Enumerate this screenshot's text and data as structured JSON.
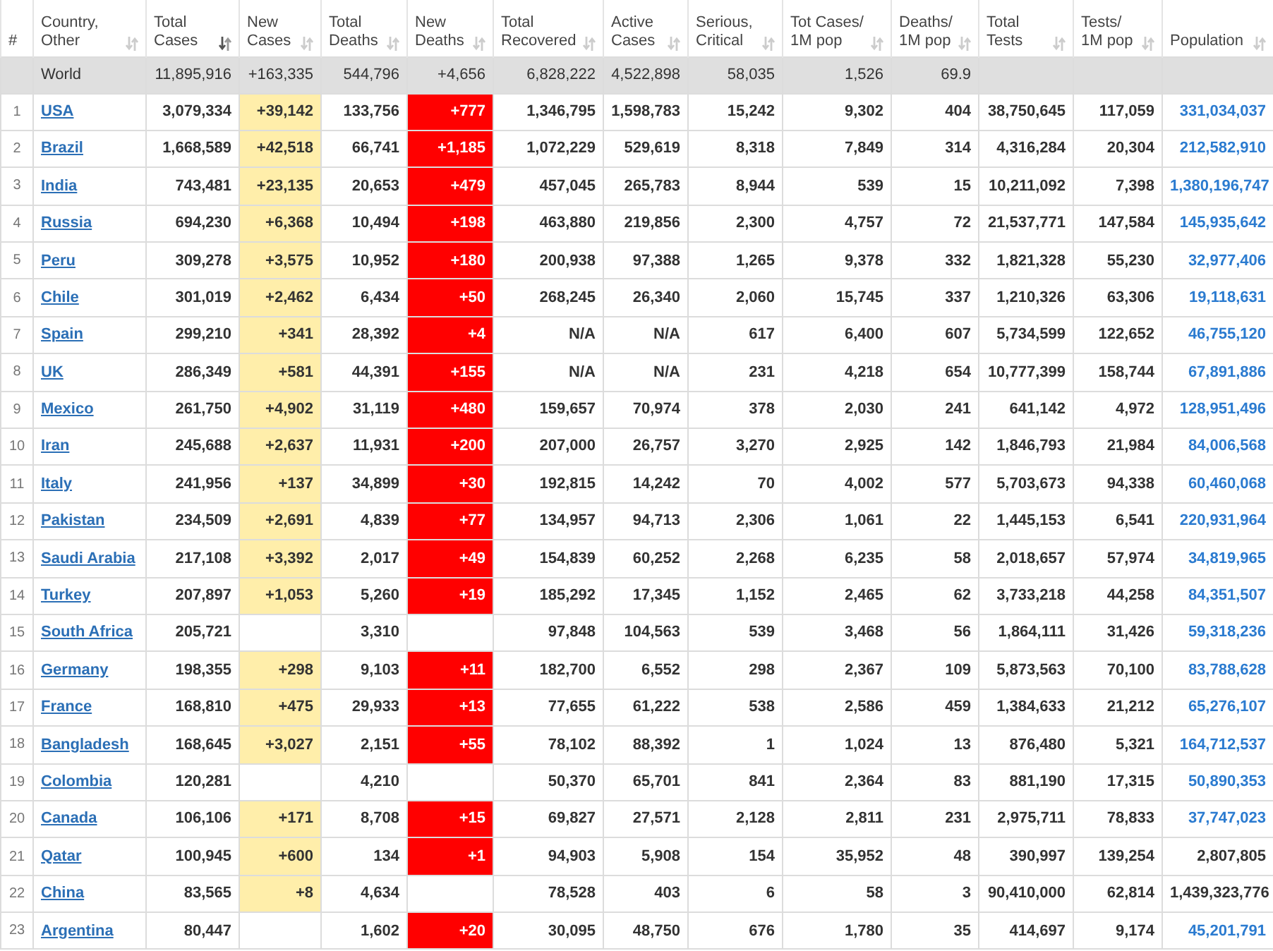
{
  "columns": [
    {
      "label_lines": [
        "#"
      ],
      "sortable": false
    },
    {
      "label_lines": [
        "Country,",
        "Other"
      ],
      "sortable": true,
      "sorted": false
    },
    {
      "label_lines": [
        "Total",
        "Cases"
      ],
      "sortable": true,
      "sorted": true
    },
    {
      "label_lines": [
        "New",
        "Cases"
      ],
      "sortable": true,
      "sorted": false
    },
    {
      "label_lines": [
        "Total",
        "Deaths"
      ],
      "sortable": true,
      "sorted": false
    },
    {
      "label_lines": [
        "New",
        "Deaths"
      ],
      "sortable": true,
      "sorted": false
    },
    {
      "label_lines": [
        "Total",
        "Recovered"
      ],
      "sortable": true,
      "sorted": false
    },
    {
      "label_lines": [
        "Active",
        "Cases"
      ],
      "sortable": true,
      "sorted": false
    },
    {
      "label_lines": [
        "Serious,",
        "Critical"
      ],
      "sortable": true,
      "sorted": false
    },
    {
      "label_lines": [
        "Tot Cases/",
        "1M pop"
      ],
      "sortable": true,
      "sorted": false
    },
    {
      "label_lines": [
        "Deaths/",
        "1M pop"
      ],
      "sortable": true,
      "sorted": false
    },
    {
      "label_lines": [
        "Total",
        "Tests"
      ],
      "sortable": true,
      "sorted": false
    },
    {
      "label_lines": [
        "Tests/",
        "1M pop"
      ],
      "sortable": true,
      "sorted": false
    },
    {
      "label_lines": [
        "Population"
      ],
      "sortable": true,
      "sorted": false
    }
  ],
  "world": {
    "country": "World",
    "total_cases": "11,895,916",
    "new_cases": "+163,335",
    "total_deaths": "544,796",
    "new_deaths": "+4,656",
    "total_recovered": "6,828,222",
    "active_cases": "4,522,898",
    "serious_critical": "58,035",
    "tot_cases_per_1m": "1,526",
    "deaths_per_1m": "69.9"
  },
  "rows": [
    {
      "num": "1",
      "country": "USA",
      "total_cases": "3,079,334",
      "new_cases": "+39,142",
      "total_deaths": "133,756",
      "new_deaths": "+777",
      "total_recovered": "1,346,795",
      "active_cases": "1,598,783",
      "serious_critical": "15,242",
      "tot_cases_per_1m": "9,302",
      "deaths_per_1m": "404",
      "total_tests": "38,750,645",
      "tests_per_1m": "117,059",
      "population": "331,034,037",
      "population_link": true
    },
    {
      "num": "2",
      "country": "Brazil",
      "total_cases": "1,668,589",
      "new_cases": "+42,518",
      "total_deaths": "66,741",
      "new_deaths": "+1,185",
      "total_recovered": "1,072,229",
      "active_cases": "529,619",
      "serious_critical": "8,318",
      "tot_cases_per_1m": "7,849",
      "deaths_per_1m": "314",
      "total_tests": "4,316,284",
      "tests_per_1m": "20,304",
      "population": "212,582,910",
      "population_link": true
    },
    {
      "num": "3",
      "country": "India",
      "total_cases": "743,481",
      "new_cases": "+23,135",
      "total_deaths": "20,653",
      "new_deaths": "+479",
      "total_recovered": "457,045",
      "active_cases": "265,783",
      "serious_critical": "8,944",
      "tot_cases_per_1m": "539",
      "deaths_per_1m": "15",
      "total_tests": "10,211,092",
      "tests_per_1m": "7,398",
      "population": "1,380,196,747",
      "population_link": true
    },
    {
      "num": "4",
      "country": "Russia",
      "total_cases": "694,230",
      "new_cases": "+6,368",
      "total_deaths": "10,494",
      "new_deaths": "+198",
      "total_recovered": "463,880",
      "active_cases": "219,856",
      "serious_critical": "2,300",
      "tot_cases_per_1m": "4,757",
      "deaths_per_1m": "72",
      "total_tests": "21,537,771",
      "tests_per_1m": "147,584",
      "population": "145,935,642",
      "population_link": true
    },
    {
      "num": "5",
      "country": "Peru",
      "total_cases": "309,278",
      "new_cases": "+3,575",
      "total_deaths": "10,952",
      "new_deaths": "+180",
      "total_recovered": "200,938",
      "active_cases": "97,388",
      "serious_critical": "1,265",
      "tot_cases_per_1m": "9,378",
      "deaths_per_1m": "332",
      "total_tests": "1,821,328",
      "tests_per_1m": "55,230",
      "population": "32,977,406",
      "population_link": true
    },
    {
      "num": "6",
      "country": "Chile",
      "total_cases": "301,019",
      "new_cases": "+2,462",
      "total_deaths": "6,434",
      "new_deaths": "+50",
      "total_recovered": "268,245",
      "active_cases": "26,340",
      "serious_critical": "2,060",
      "tot_cases_per_1m": "15,745",
      "deaths_per_1m": "337",
      "total_tests": "1,210,326",
      "tests_per_1m": "63,306",
      "population": "19,118,631",
      "population_link": true
    },
    {
      "num": "7",
      "country": "Spain",
      "total_cases": "299,210",
      "new_cases": "+341",
      "total_deaths": "28,392",
      "new_deaths": "+4",
      "total_recovered": "N/A",
      "active_cases": "N/A",
      "serious_critical": "617",
      "tot_cases_per_1m": "6,400",
      "deaths_per_1m": "607",
      "total_tests": "5,734,599",
      "tests_per_1m": "122,652",
      "population": "46,755,120",
      "population_link": true
    },
    {
      "num": "8",
      "country": "UK",
      "total_cases": "286,349",
      "new_cases": "+581",
      "total_deaths": "44,391",
      "new_deaths": "+155",
      "total_recovered": "N/A",
      "active_cases": "N/A",
      "serious_critical": "231",
      "tot_cases_per_1m": "4,218",
      "deaths_per_1m": "654",
      "total_tests": "10,777,399",
      "tests_per_1m": "158,744",
      "population": "67,891,886",
      "population_link": true
    },
    {
      "num": "9",
      "country": "Mexico",
      "total_cases": "261,750",
      "new_cases": "+4,902",
      "total_deaths": "31,119",
      "new_deaths": "+480",
      "total_recovered": "159,657",
      "active_cases": "70,974",
      "serious_critical": "378",
      "tot_cases_per_1m": "2,030",
      "deaths_per_1m": "241",
      "total_tests": "641,142",
      "tests_per_1m": "4,972",
      "population": "128,951,496",
      "population_link": true
    },
    {
      "num": "10",
      "country": "Iran",
      "total_cases": "245,688",
      "new_cases": "+2,637",
      "total_deaths": "11,931",
      "new_deaths": "+200",
      "total_recovered": "207,000",
      "active_cases": "26,757",
      "serious_critical": "3,270",
      "tot_cases_per_1m": "2,925",
      "deaths_per_1m": "142",
      "total_tests": "1,846,793",
      "tests_per_1m": "21,984",
      "population": "84,006,568",
      "population_link": true
    },
    {
      "num": "11",
      "country": "Italy",
      "total_cases": "241,956",
      "new_cases": "+137",
      "total_deaths": "34,899",
      "new_deaths": "+30",
      "total_recovered": "192,815",
      "active_cases": "14,242",
      "serious_critical": "70",
      "tot_cases_per_1m": "4,002",
      "deaths_per_1m": "577",
      "total_tests": "5,703,673",
      "tests_per_1m": "94,338",
      "population": "60,460,068",
      "population_link": true
    },
    {
      "num": "12",
      "country": "Pakistan",
      "total_cases": "234,509",
      "new_cases": "+2,691",
      "total_deaths": "4,839",
      "new_deaths": "+77",
      "total_recovered": "134,957",
      "active_cases": "94,713",
      "serious_critical": "2,306",
      "tot_cases_per_1m": "1,061",
      "deaths_per_1m": "22",
      "total_tests": "1,445,153",
      "tests_per_1m": "6,541",
      "population": "220,931,964",
      "population_link": true
    },
    {
      "num": "13",
      "country": "Saudi Arabia",
      "total_cases": "217,108",
      "new_cases": "+3,392",
      "total_deaths": "2,017",
      "new_deaths": "+49",
      "total_recovered": "154,839",
      "active_cases": "60,252",
      "serious_critical": "2,268",
      "tot_cases_per_1m": "6,235",
      "deaths_per_1m": "58",
      "total_tests": "2,018,657",
      "tests_per_1m": "57,974",
      "population": "34,819,965",
      "population_link": true
    },
    {
      "num": "14",
      "country": "Turkey",
      "total_cases": "207,897",
      "new_cases": "+1,053",
      "total_deaths": "5,260",
      "new_deaths": "+19",
      "total_recovered": "185,292",
      "active_cases": "17,345",
      "serious_critical": "1,152",
      "tot_cases_per_1m": "2,465",
      "deaths_per_1m": "62",
      "total_tests": "3,733,218",
      "tests_per_1m": "44,258",
      "population": "84,351,507",
      "population_link": true
    },
    {
      "num": "15",
      "country": "South Africa",
      "total_cases": "205,721",
      "total_deaths": "3,310",
      "total_recovered": "97,848",
      "active_cases": "104,563",
      "serious_critical": "539",
      "tot_cases_per_1m": "3,468",
      "deaths_per_1m": "56",
      "total_tests": "1,864,111",
      "tests_per_1m": "31,426",
      "population": "59,318,236",
      "population_link": true
    },
    {
      "num": "16",
      "country": "Germany",
      "total_cases": "198,355",
      "new_cases": "+298",
      "total_deaths": "9,103",
      "new_deaths": "+11",
      "total_recovered": "182,700",
      "active_cases": "6,552",
      "serious_critical": "298",
      "tot_cases_per_1m": "2,367",
      "deaths_per_1m": "109",
      "total_tests": "5,873,563",
      "tests_per_1m": "70,100",
      "population": "83,788,628",
      "population_link": true
    },
    {
      "num": "17",
      "country": "France",
      "total_cases": "168,810",
      "new_cases": "+475",
      "total_deaths": "29,933",
      "new_deaths": "+13",
      "total_recovered": "77,655",
      "active_cases": "61,222",
      "serious_critical": "538",
      "tot_cases_per_1m": "2,586",
      "deaths_per_1m": "459",
      "total_tests": "1,384,633",
      "tests_per_1m": "21,212",
      "population": "65,276,107",
      "population_link": true
    },
    {
      "num": "18",
      "country": "Bangladesh",
      "total_cases": "168,645",
      "new_cases": "+3,027",
      "total_deaths": "2,151",
      "new_deaths": "+55",
      "total_recovered": "78,102",
      "active_cases": "88,392",
      "serious_critical": "1",
      "tot_cases_per_1m": "1,024",
      "deaths_per_1m": "13",
      "total_tests": "876,480",
      "tests_per_1m": "5,321",
      "population": "164,712,537",
      "population_link": true
    },
    {
      "num": "19",
      "country": "Colombia",
      "total_cases": "120,281",
      "total_deaths": "4,210",
      "total_recovered": "50,370",
      "active_cases": "65,701",
      "serious_critical": "841",
      "tot_cases_per_1m": "2,364",
      "deaths_per_1m": "83",
      "total_tests": "881,190",
      "tests_per_1m": "17,315",
      "population": "50,890,353",
      "population_link": true
    },
    {
      "num": "20",
      "country": "Canada",
      "total_cases": "106,106",
      "new_cases": "+171",
      "total_deaths": "8,708",
      "new_deaths": "+15",
      "total_recovered": "69,827",
      "active_cases": "27,571",
      "serious_critical": "2,128",
      "tot_cases_per_1m": "2,811",
      "deaths_per_1m": "231",
      "total_tests": "2,975,711",
      "tests_per_1m": "78,833",
      "population": "37,747,023",
      "population_link": true
    },
    {
      "num": "21",
      "country": "Qatar",
      "total_cases": "100,945",
      "new_cases": "+600",
      "total_deaths": "134",
      "new_deaths": "+1",
      "total_recovered": "94,903",
      "active_cases": "5,908",
      "serious_critical": "154",
      "tot_cases_per_1m": "35,952",
      "deaths_per_1m": "48",
      "total_tests": "390,997",
      "tests_per_1m": "139,254",
      "population": "2,807,805",
      "population_link": false
    },
    {
      "num": "22",
      "country": "China",
      "total_cases": "83,565",
      "new_cases": "+8",
      "total_deaths": "4,634",
      "total_recovered": "78,528",
      "active_cases": "403",
      "serious_critical": "6",
      "tot_cases_per_1m": "58",
      "deaths_per_1m": "3",
      "total_tests": "90,410,000",
      "tests_per_1m": "62,814",
      "population": "1,439,323,776",
      "population_link": false
    },
    {
      "num": "23",
      "country": "Argentina",
      "total_cases": "80,447",
      "total_deaths": "1,602",
      "new_deaths": "+20",
      "total_recovered": "30,095",
      "active_cases": "48,750",
      "serious_critical": "676",
      "tot_cases_per_1m": "1,780",
      "deaths_per_1m": "35",
      "total_tests": "414,697",
      "tests_per_1m": "9,174",
      "population": "45,201,791",
      "population_link": true
    }
  ]
}
